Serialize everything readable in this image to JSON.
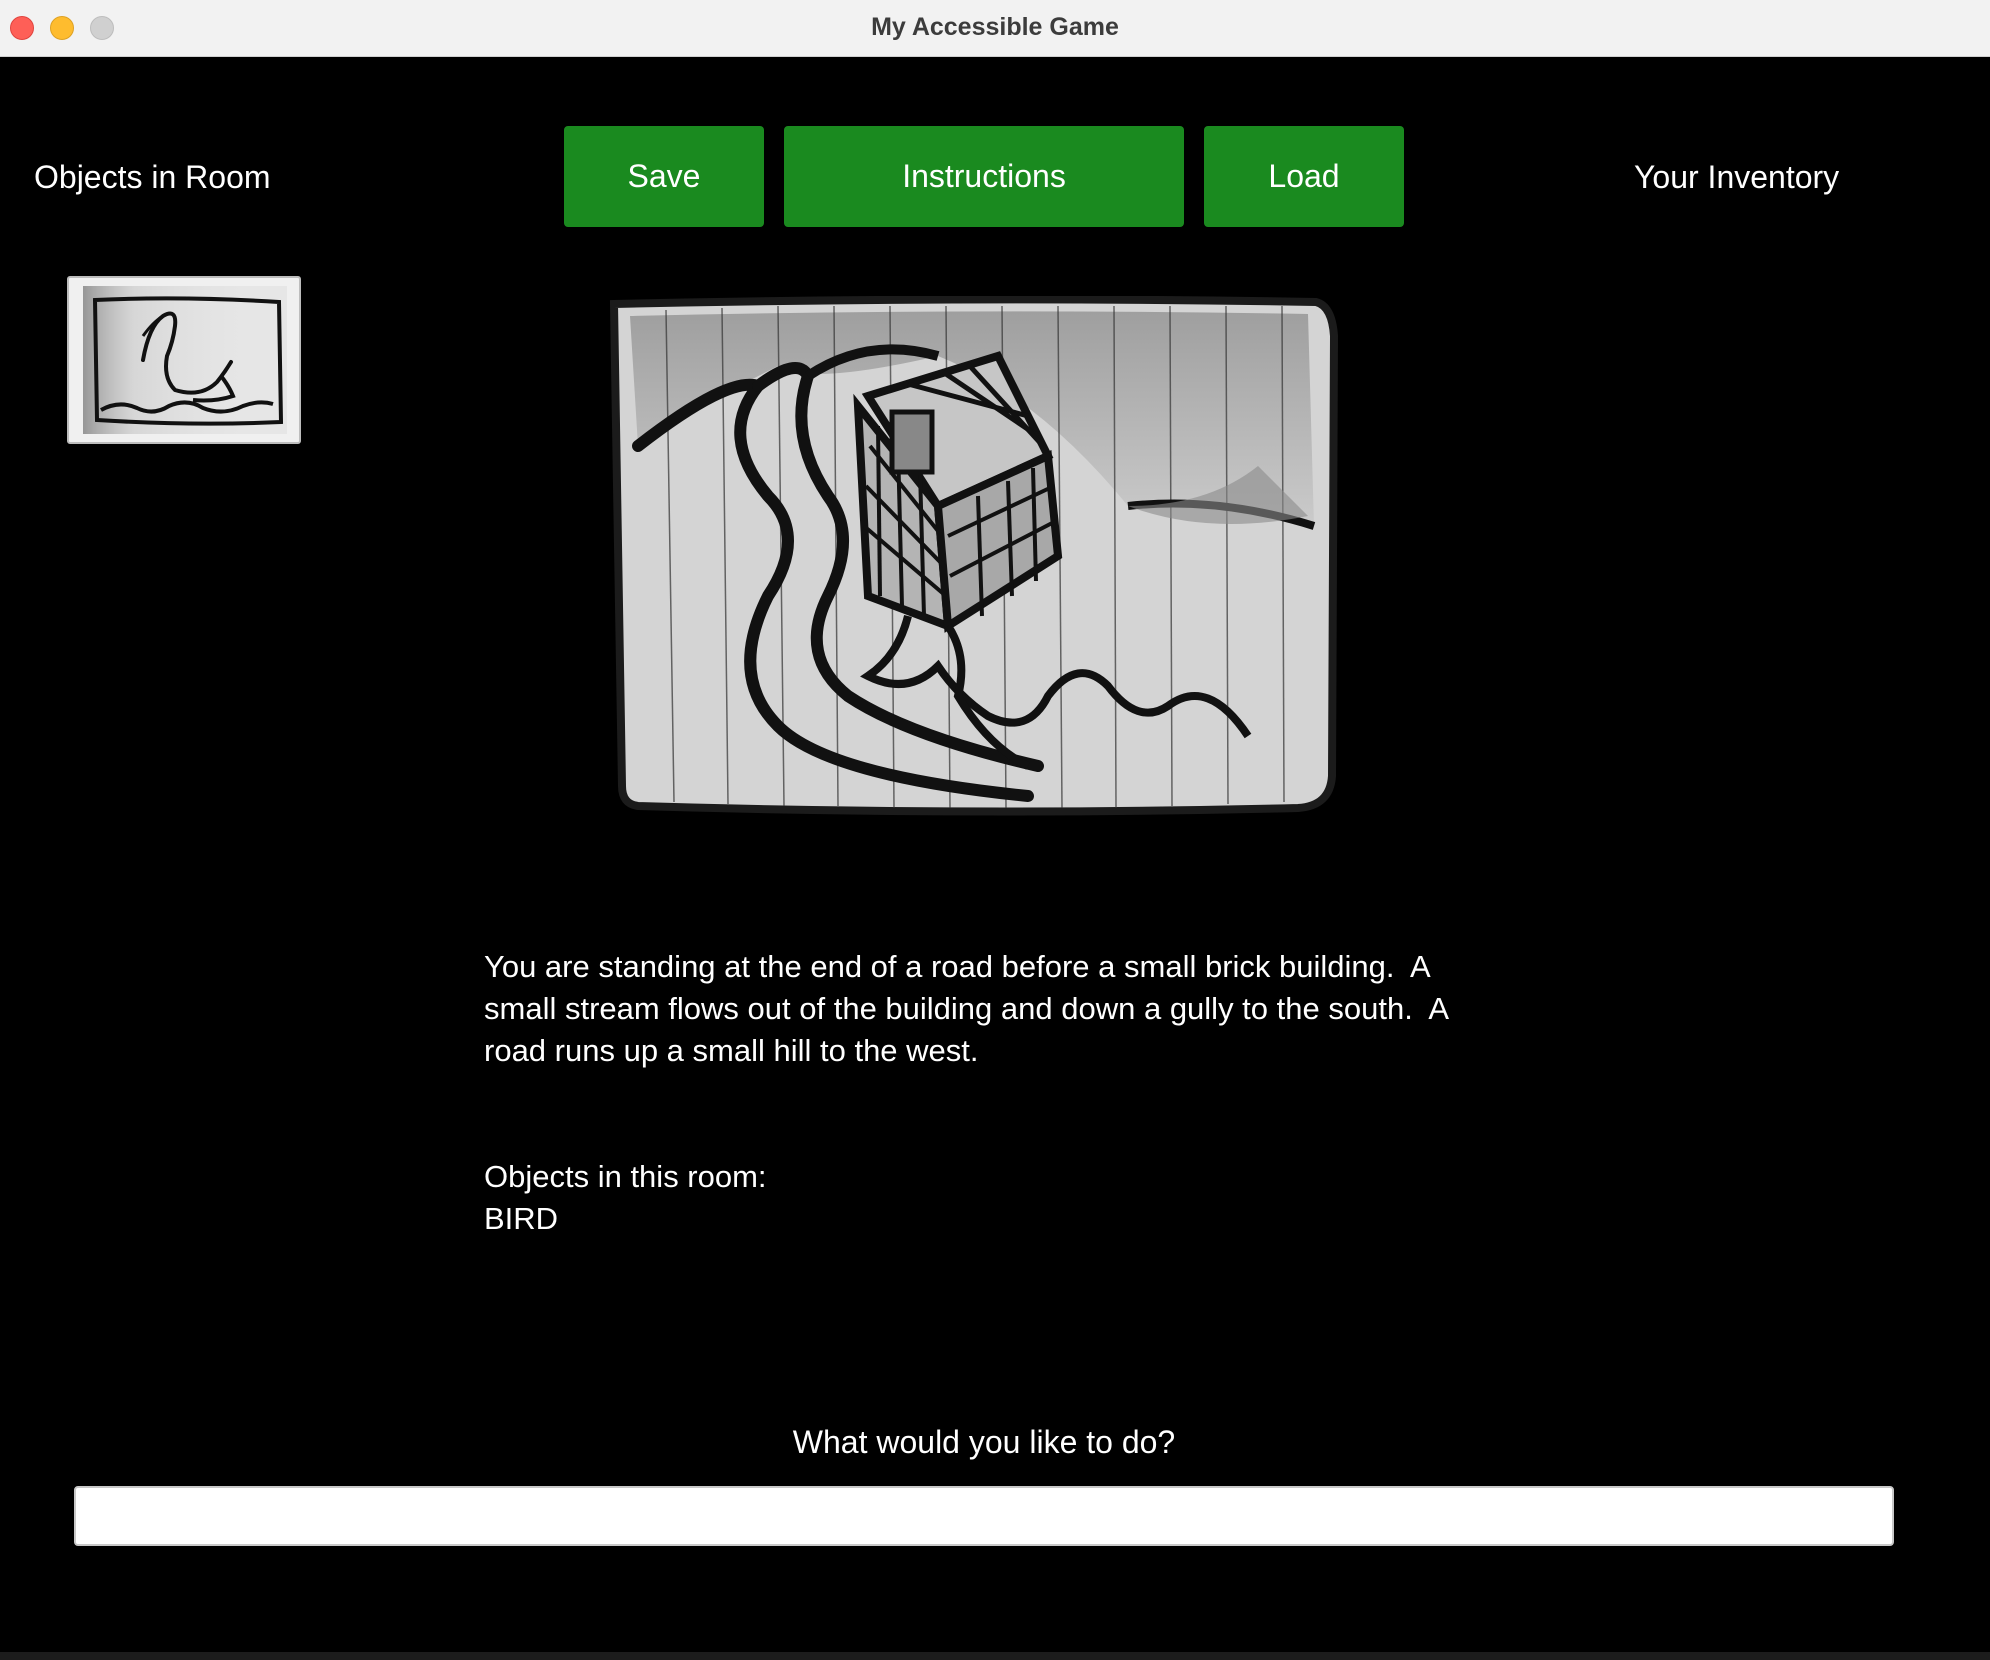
{
  "window": {
    "title": "My Accessible Game"
  },
  "header": {
    "objects_label": "Objects in Room",
    "inventory_label": "Your Inventory",
    "save_label": "Save",
    "instructions_label": "Instructions",
    "load_label": "Load"
  },
  "room": {
    "objects": [
      {
        "name": "BIRD",
        "icon": "bird-sketch-icon"
      }
    ],
    "scene_icon": "brick-building-sketch",
    "description": "You are standing at the end of a road before a small brick building.  A\nsmall stream flows out of the building and down a gully to the south.  A\nroad runs up a small hill to the west.",
    "objects_heading": "Objects in this room:",
    "objects_list": "BIRD"
  },
  "command": {
    "prompt": "What would you like to do?",
    "value": "",
    "placeholder": ""
  },
  "colors": {
    "background": "#000000",
    "button": "#1a8a1f",
    "text": "#ffffff"
  }
}
